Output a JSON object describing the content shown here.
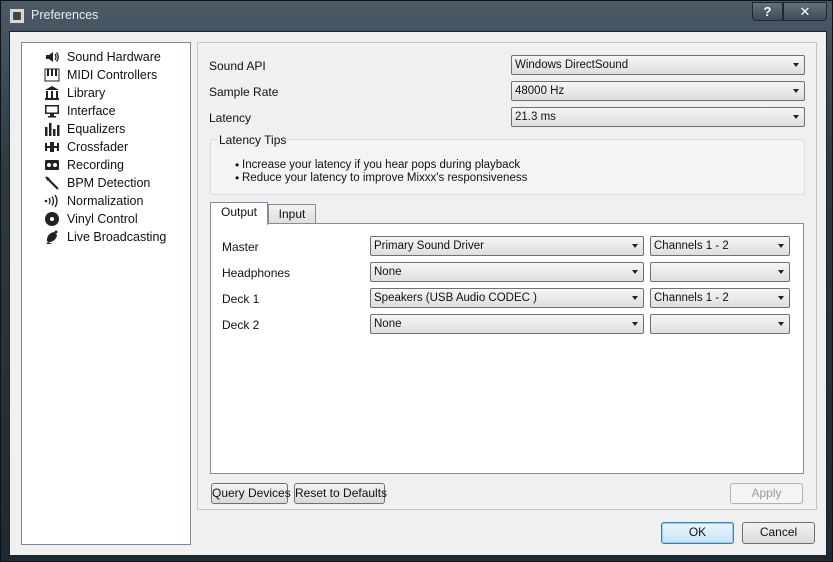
{
  "window": {
    "title": "Preferences",
    "help_label": "?",
    "close_label": "✕"
  },
  "sidebar": {
    "items": [
      {
        "label": "Sound Hardware",
        "icon": "speaker-icon"
      },
      {
        "label": "MIDI Controllers",
        "icon": "keyboard-icon"
      },
      {
        "label": "Library",
        "icon": "library-icon"
      },
      {
        "label": "Interface",
        "icon": "monitor-icon"
      },
      {
        "label": "Equalizers",
        "icon": "equalizer-icon"
      },
      {
        "label": "Crossfader",
        "icon": "crossfader-icon"
      },
      {
        "label": "Recording",
        "icon": "tape-icon"
      },
      {
        "label": "BPM Detection",
        "icon": "wand-icon"
      },
      {
        "label": "Normalization",
        "icon": "waves-icon"
      },
      {
        "label": "Vinyl Control",
        "icon": "vinyl-icon"
      },
      {
        "label": "Live Broadcasting",
        "icon": "satellite-icon"
      }
    ]
  },
  "settings": {
    "sound_api": {
      "label": "Sound API",
      "value": "Windows DirectSound"
    },
    "sample_rate": {
      "label": "Sample Rate",
      "value": "48000 Hz"
    },
    "latency": {
      "label": "Latency",
      "value": "21.3 ms"
    }
  },
  "latency_tips": {
    "title": "Latency Tips",
    "tips": [
      "Increase your latency if you hear pops during playback",
      "Reduce your latency to improve Mixxx's responsiveness"
    ]
  },
  "tabs": [
    {
      "label": "Output",
      "active": true
    },
    {
      "label": "Input",
      "active": false
    }
  ],
  "outputs": [
    {
      "label": "Master",
      "device": "Primary Sound Driver",
      "channels": "Channels 1 - 2"
    },
    {
      "label": "Headphones",
      "device": "None",
      "channels": ""
    },
    {
      "label": "Deck 1",
      "device": "Speakers (USB Audio CODEC )",
      "channels": "Channels 1 - 2"
    },
    {
      "label": "Deck 2",
      "device": "None",
      "channels": ""
    }
  ],
  "buttons": {
    "query_devices": "Query Devices",
    "reset_defaults": "Reset to Defaults",
    "apply": "Apply",
    "ok": "OK",
    "cancel": "Cancel"
  },
  "colors": {
    "titlebar": "#2d3a44",
    "client_bg": "#f0f0f0",
    "default_button_border": "#3c7fb1"
  }
}
